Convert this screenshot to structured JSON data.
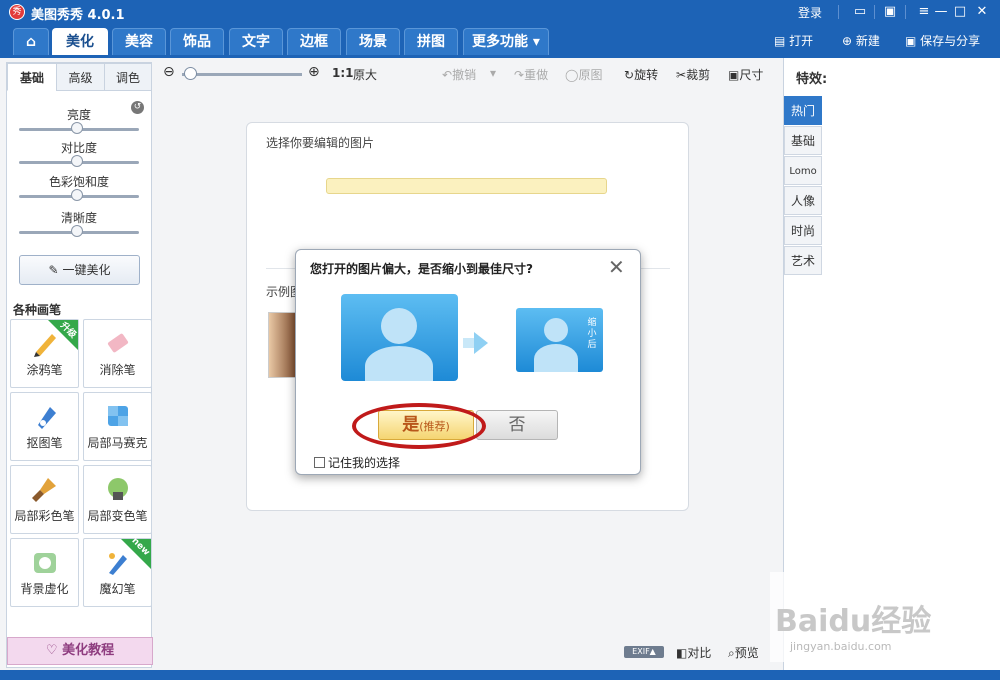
{
  "title": {
    "logo": "秀",
    "name": "美图秀秀 4.0.1",
    "login": "登录",
    "icons": [
      "chat-icon",
      "skin-icon",
      "menu-icon",
      "minimize-icon",
      "maximize-icon",
      "close-icon"
    ]
  },
  "nav": {
    "home_icon": "home-icon",
    "tabs": [
      "美化",
      "美容",
      "饰品",
      "文字",
      "边框",
      "场景",
      "拼图",
      "更多功能 ▾"
    ],
    "open": "打开",
    "new": "新建",
    "save_share": "保存与分享"
  },
  "left": {
    "subtabs": [
      "基础",
      "高级",
      "调色"
    ],
    "sliders": [
      "亮度",
      "对比度",
      "色彩饱和度",
      "清晰度"
    ],
    "one_key": "一键美化",
    "brushes_title": "各种画笔",
    "brushes": [
      {
        "label": "涂鸦笔",
        "badge": "升级"
      },
      {
        "label": "消除笔",
        "badge": ""
      },
      {
        "label": "抠图笔",
        "badge": ""
      },
      {
        "label": "局部马赛克",
        "badge": ""
      },
      {
        "label": "局部彩色笔",
        "badge": ""
      },
      {
        "label": "局部变色笔",
        "badge": ""
      },
      {
        "label": "背景虚化",
        "badge": ""
      },
      {
        "label": "魔幻笔",
        "badge": "new"
      }
    ],
    "tutorial": "美化教程"
  },
  "toolbar": {
    "ratio": "1:1",
    "original_size": "原大",
    "undo": "撤销",
    "redo": "重做",
    "original": "原图",
    "rotate": "旋转",
    "crop": "裁剪",
    "resize": "尺寸"
  },
  "canvas": {
    "choose": "选择你要编辑的图片",
    "example": "示例图"
  },
  "right": {
    "title": "特效:",
    "tabs": [
      "热门",
      "基础",
      "Lomo",
      "人像",
      "时尚",
      "艺术"
    ]
  },
  "bottom": {
    "exif": "EXIF▲",
    "compare": "对比",
    "preview": "预览"
  },
  "dialog": {
    "question": "您打开的图片偏大，是否缩小到最佳尺寸?",
    "small_tag": "缩小后",
    "yes": "是",
    "yes_note": "(推荐)",
    "no": "否",
    "remember": "记住我的选择"
  },
  "watermark": {
    "brand": "Baidu经验",
    "url": "jingyan.baidu.com"
  },
  "colors": {
    "brand_blue": "#1d63b6",
    "highlight_ring": "#c01a1a",
    "yes_button": "#f5d572"
  }
}
